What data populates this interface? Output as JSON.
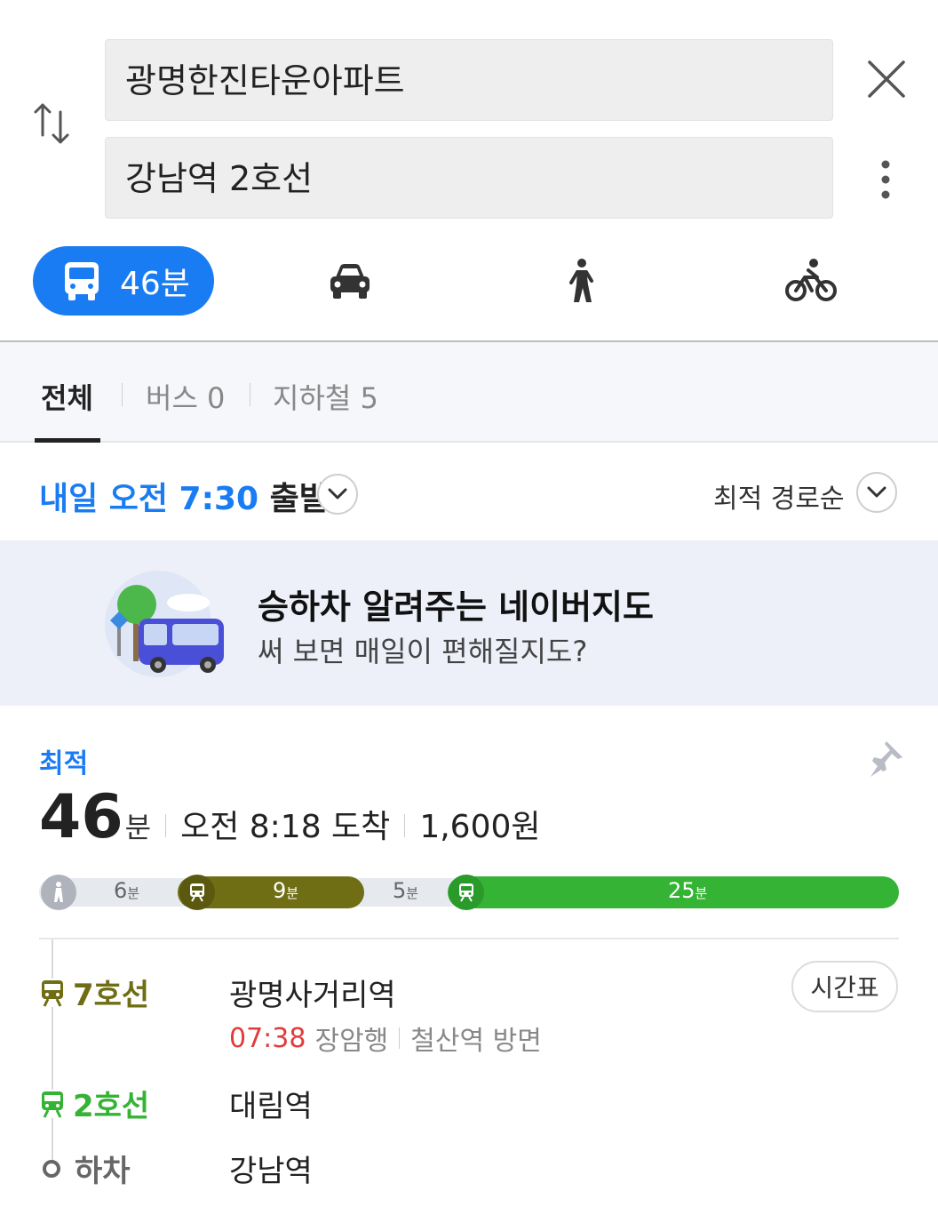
{
  "search": {
    "origin": "광명한진타운아파트",
    "destination": "강남역 2호선"
  },
  "modes": {
    "transit_label": "46분"
  },
  "filter_tabs": [
    {
      "label": "전체"
    },
    {
      "label": "버스 0"
    },
    {
      "label": "지하철 5"
    }
  ],
  "departure": {
    "time_label": "내일 오전 7:30",
    "suffix": "출발",
    "sort_label": "최적 경로순"
  },
  "banner": {
    "title": "승하차 알려주는 네이버지도",
    "subtitle": "써 보면 매일이 편해질지도?"
  },
  "route": {
    "badge": "최적",
    "duration_value": "46",
    "duration_unit": "분",
    "arrival": "오전 8:18 도착",
    "fare": "1,600원",
    "timeline": [
      {
        "type": "walk",
        "minutes": "6",
        "unit": "분"
      },
      {
        "type": "subway-line7",
        "minutes": "9",
        "unit": "분"
      },
      {
        "type": "walk",
        "minutes": "5",
        "unit": "분"
      },
      {
        "type": "subway-line2",
        "minutes": "25",
        "unit": "분"
      }
    ],
    "steps": {
      "line7": {
        "line": "7호선",
        "station": "광명사거리역",
        "time": "07:38",
        "direction": "장암행",
        "bound": "철산역 방면",
        "timetable": "시간표"
      },
      "line2": {
        "line": "2호선",
        "station": "대림역"
      },
      "alight": {
        "label": "하차",
        "station": "강남역"
      }
    }
  },
  "colors": {
    "accent_blue": "#1a7cf2",
    "line7_olive": "#6f6e14",
    "line2_green": "#35b335",
    "time_red": "#e23b3b"
  }
}
